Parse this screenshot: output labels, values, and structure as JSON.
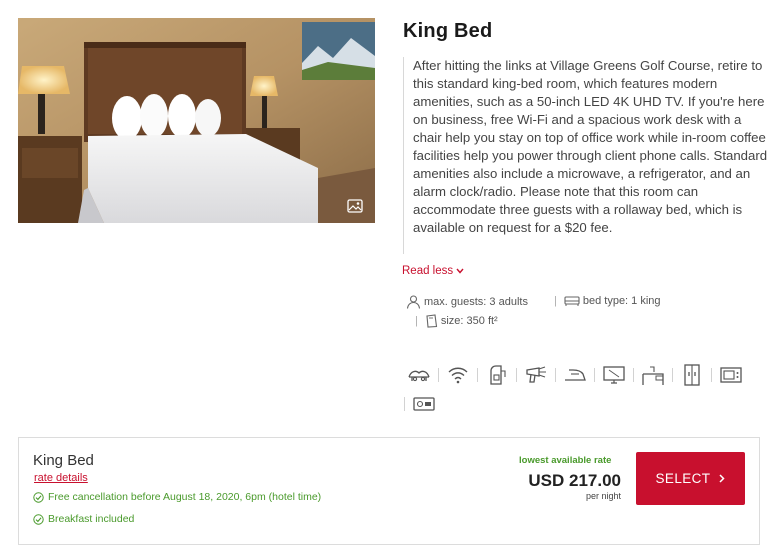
{
  "room": {
    "title": "King Bed",
    "description": "After hitting the links at Village Greens Golf Course, retire to this standard king-bed room, which features modern amenities, such as a 50-inch LED 4K UHD TV. If you're here on business, free Wi-Fi and a spacious work desk with a chair help you stay on top of office work while in-room coffee facilities help you power through client phone calls. Standard amenities also include a microwave, a refrigerator, and an alarm clock/radio. Please note that this room can accommodate three guests with a rollaway bed, which is available on request for a $20 fee.",
    "read_less": "Read less",
    "features": {
      "max_guests": "max. guests: 3 adults",
      "bed_type": "bed type: 1 king",
      "size": "size: 350 ft²"
    },
    "amenities": [
      "rollaway-bed-icon",
      "wifi-icon",
      "coffee-maker-icon",
      "hair-dryer-icon",
      "iron-icon",
      "tv-icon",
      "desk-icon",
      "refrigerator-icon",
      "microwave-icon",
      "alarm-clock-radio-icon"
    ]
  },
  "rate": {
    "title": "King Bed",
    "details_link": "rate details",
    "perks": [
      "Free cancellation before August 18, 2020, 6pm (hotel time)",
      "Breakfast included"
    ],
    "lowest_label": "lowest available rate",
    "price": "USD 217.00",
    "per_night": "per night",
    "select_label": "SELECT",
    "accent": "#c8102e",
    "perk_color": "#4a9a2c"
  }
}
